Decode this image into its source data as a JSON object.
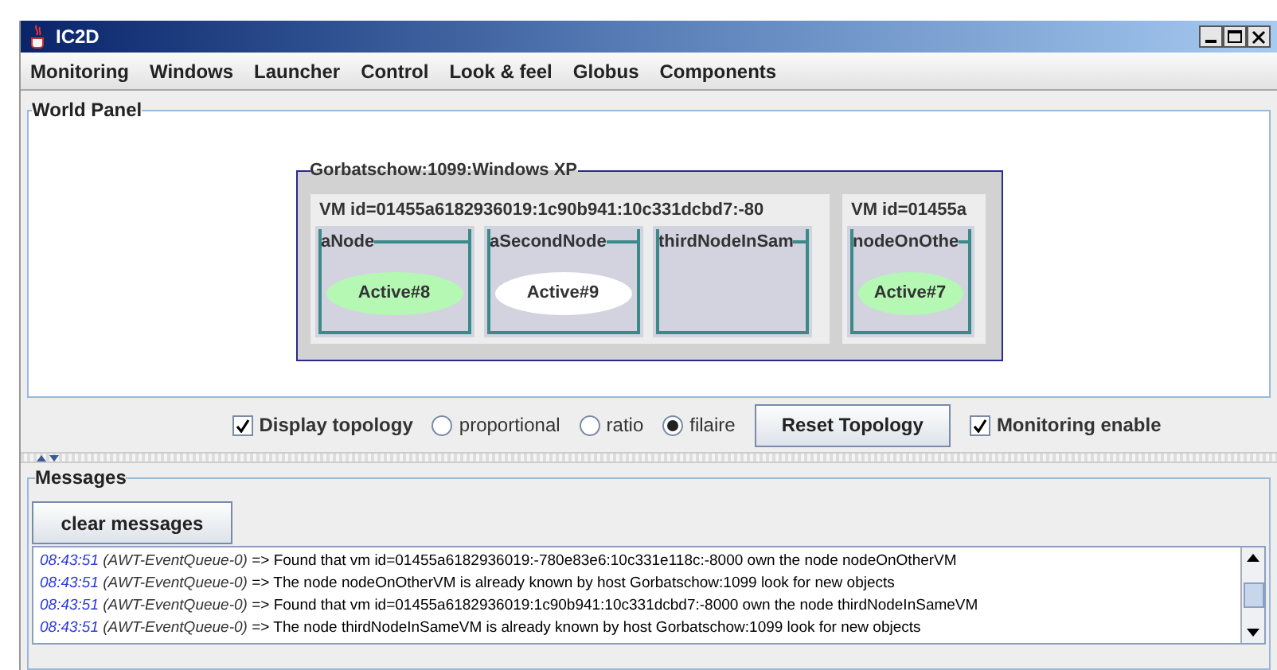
{
  "window": {
    "title": "IC2D"
  },
  "menu": [
    "Monitoring",
    "Windows",
    "Launcher",
    "Control",
    "Look & feel",
    "Globus",
    "Components"
  ],
  "world_panel": {
    "title": "World Panel",
    "hosts": [
      {
        "title": "Gorbatschow:1099:Windows XP",
        "vms": [
          {
            "title": "VM id=01455a6182936019:1c90b941:10c331dcbd7:-80",
            "nodes": [
              {
                "name": "aNode",
                "objects": [
                  {
                    "label": "Active#8",
                    "color": "#b4f8b4"
                  }
                ]
              },
              {
                "name": "aSecondNode",
                "objects": [
                  {
                    "label": "Active#9",
                    "color": "#ffffff"
                  }
                ]
              },
              {
                "name": "thirdNodeInSam"
              }
            ]
          },
          {
            "title": "VM id=01455a",
            "nodes": [
              {
                "name": "nodeOnOthe",
                "objects": [
                  {
                    "label": "Active#7",
                    "color": "#b4f8b4"
                  }
                ]
              }
            ]
          }
        ]
      }
    ]
  },
  "controls": [
    {
      "kind": "checkbox",
      "label": "Display topology",
      "checked": true
    },
    {
      "kind": "radio",
      "label": "proportional",
      "selected": false
    },
    {
      "kind": "radio",
      "label": "ratio",
      "selected": false
    },
    {
      "kind": "radio",
      "label": "filaire",
      "selected": true
    },
    {
      "kind": "button",
      "label": "Reset Topology"
    },
    {
      "kind": "checkbox",
      "label": "Monitoring enable",
      "checked": true
    }
  ],
  "messages": {
    "title": "Messages",
    "button": "clear messages",
    "log": [
      {
        "time": "08:43:51",
        "thread": "(AWT-EventQueue-0)",
        "text": "=> Found that vm id=01455a6182936019:-780e83e6:10c331e118c:-8000 own the node nodeOnOtherVM"
      },
      {
        "time": "08:43:51",
        "thread": "(AWT-EventQueue-0)",
        "text": "=> The node nodeOnOtherVM is already known by host Gorbatschow:1099 look for new objects"
      },
      {
        "time": "08:43:51",
        "thread": "(AWT-EventQueue-0)",
        "text": "=> Found that vm id=01455a6182936019:1c90b941:10c331dcbd7:-8000 own the node thirdNodeInSameVM"
      },
      {
        "time": "08:43:51",
        "thread": "(AWT-EventQueue-0)",
        "text": "=> The node thirdNodeInSameVM is already known by host Gorbatschow:1099 look for new objects"
      }
    ]
  }
}
